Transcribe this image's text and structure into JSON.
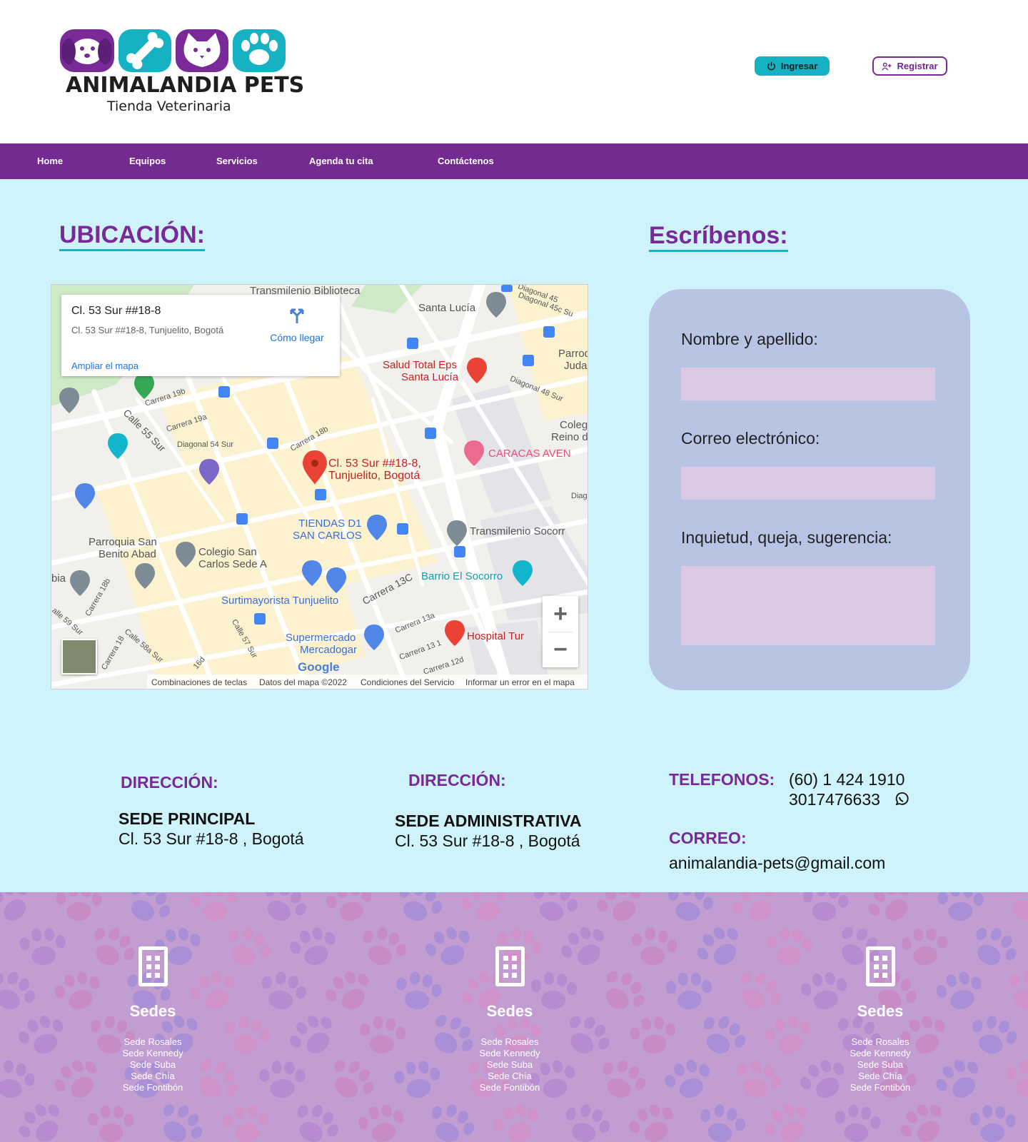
{
  "brand": {
    "name": "ANIMALANDIA PETS",
    "tagline": "Tienda Veterinaria",
    "colors": {
      "purple": "#7a2a97",
      "teal": "#17b1c4",
      "nav": "#732a91",
      "background": "#cff3fa"
    }
  },
  "header": {
    "login_label": "Ingresar",
    "login_icon": "power-icon",
    "register_label": "Registrar",
    "register_icon": "user-plus-icon"
  },
  "nav": {
    "items": [
      "Home",
      "Equipos",
      "Servicios",
      "Agenda tu cita",
      "Contáctenos"
    ]
  },
  "location": {
    "title": "UBICACIÓN:",
    "map": {
      "card_title": "Cl. 53 Sur ##18-8",
      "card_address": "Cl. 53 Sur ##18-8, Tunjuelito, Bogotá",
      "directions_label": "Cómo llegar",
      "expand_label": "Ampliar el mapa",
      "pin_label_1": "Cl. 53 Sur ##18-8,",
      "pin_label_2": "Tunjuelito, Bogotá",
      "places": {
        "transmilenio_biblioteca": "Transmilenio Biblioteca",
        "santa_lucia": "Santa Lucía",
        "salud_total_1": "Salud Total Eps",
        "salud_total_2": "Santa Lucía",
        "parroquia_judas_1": "Parroq",
        "parroquia_judas_2": "Judas",
        "colegio_reino_1": "Colegi",
        "colegio_reino_2": "Reino de",
        "caracas": "CARACAS AVEN",
        "tiendas_d1_1": "TIENDAS D1",
        "tiendas_d1_2": "SAN CARLOS",
        "transmilenio_socorro": "Transmilenio Socorr",
        "parroquia_benito_1": "Parroquia San",
        "parroquia_benito_2": "Benito Abad",
        "colegio_carlos_1": "Colegio San",
        "colegio_carlos_2": "Carlos Sede A",
        "barrio_socorro": "Barrio El Socorro",
        "surtimayorista": "Surtimayorista Tunjuelito",
        "supermercado_1": "Supermercado",
        "supermercado_2": "Mercadogar",
        "hospital": "Hospital Tur",
        "bia": "bia"
      },
      "streets": {
        "diagonal_45": "Diagonal 45",
        "diagonal_45c": "Diagonal 45c Su",
        "diagonal_48": "Diagonal 48 Sur",
        "carrera_19b": "Carrera 19b",
        "carrera_19a": "Carrera 19a",
        "calle_55": "Calle 55 Sur",
        "diagonal_54": "Diagonal 54 Sur",
        "carrera_18b": "Carrera 18b",
        "carrera_13c": "Carrera 13C",
        "carrera_13a": "Carrera 13a",
        "carrera_131": "Carrera 13 1",
        "carrera_12d": "Carrera 12d",
        "calle_58a": "Calle 58a Sur",
        "calle_57": "Calle 57 Sur",
        "carrera_18": "Carrera 18",
        "carrera_18b_2": "Carrera 18b",
        "calle_59": "alle 59 Sur",
        "diag_right": "Diag",
        "c_16d": "16d"
      },
      "google_label": "Google",
      "footer_links": [
        "Combinaciones de teclas",
        "Datos del mapa ©2022",
        "Condiciones del Servicio",
        "Informar un error en el mapa"
      ]
    }
  },
  "contact_form": {
    "title": "Escríbenos:",
    "fields": [
      {
        "label": "Nombre y apellido:",
        "value": ""
      },
      {
        "label": "Correo electrónico:",
        "value": ""
      },
      {
        "label": "Inquietud, queja, sugerencia:",
        "value": ""
      }
    ]
  },
  "info": {
    "address_1": {
      "heading": "DIRECCIÓN:",
      "name": "SEDE PRINCIPAL",
      "address": "Cl. 53 Sur #18-8 , Bogotá"
    },
    "address_2": {
      "heading": "DIRECCIÓN:",
      "name": "SEDE ADMINISTRATIVA",
      "address": "Cl. 53 Sur #18-8 , Bogotá"
    },
    "phones": {
      "heading": "TELEFONOS:",
      "landline": "(60) 1 424 1910",
      "mobile": "3017476633",
      "mobile_icon": "whatsapp-icon"
    },
    "email": {
      "heading": "CORREO:",
      "value": "animalandia-pets@gmail.com"
    }
  },
  "footer": {
    "columns": [
      {
        "icon": "building-icon",
        "title": "Sedes",
        "items": [
          "Sede Rosales",
          "Sede Kennedy",
          "Sede Suba",
          "Sede Chía",
          "Sede Fontibón"
        ]
      },
      {
        "icon": "building-icon",
        "title": "Sedes",
        "items": [
          "Sede Rosales",
          "Sede Kennedy",
          "Sede Suba",
          "Sede Chía",
          "Sede Fontibón"
        ]
      },
      {
        "icon": "building-icon",
        "title": "Sedes",
        "items": [
          "Sede Rosales",
          "Sede Kennedy",
          "Sede Suba",
          "Sede Chía",
          "Sede Fontibón"
        ]
      }
    ]
  }
}
